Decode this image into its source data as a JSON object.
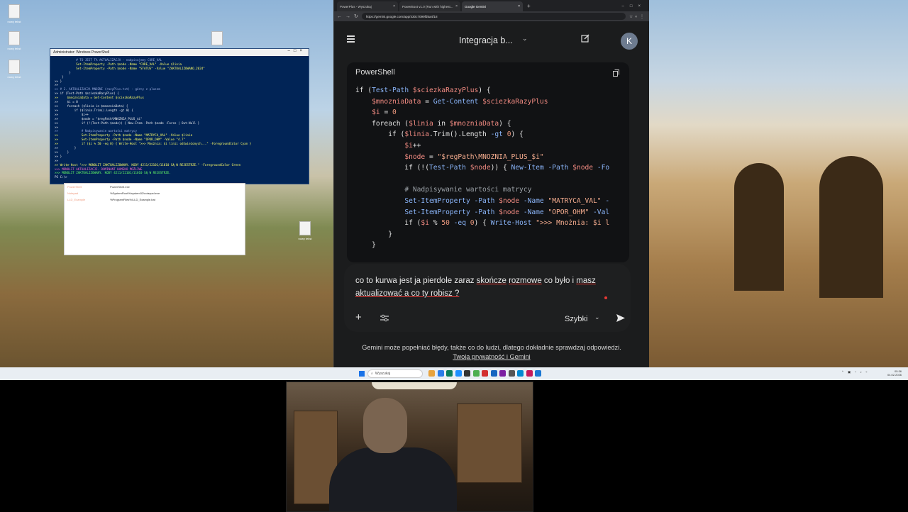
{
  "desktop": {
    "icons": [
      "nowy tekst",
      "nowy tekst",
      "nowy tekst",
      "nowy tekst",
      "nowy tekst"
    ]
  },
  "powershell": {
    "title": "Administrator: Windows PowerShell",
    "lines": [
      "            # TO JEST TA AKTUALIZACJA - nadpisujemy CORE_VAL",
      "            Set-ItemProperty -Path $node -Name \"CORE_VAL\" -Value $linia",
      "            Set-ItemProperty -Path $node -Name \"STATUS\" -Value \"ZAKTUALIZOWANO_2024\"",
      "        }",
      "    }",
      ">> }",
      ">>",
      ">> # 2. AKTUALIZACJA MNOZNI (razyPlus.txt) - górny z plusem",
      ">> if (Test-Path $sciezkaRazyPlus) {",
      ">>     $mnozniaData = Get-Content $sciezkaRazyPlus",
      ">>     $i = 0",
      ">>     foreach ($linia in $mnozniaData) {",
      ">>         if ($linia.Trim().Length -gt 0) {",
      ">>             $i++",
      ">>             $node = \"$regPath\\MNOZNIA_PLUS_$i\"",
      ">>             if (!(Test-Path $node)) { New-Item -Path $node -Force | Out-Null }",
      ">>",
      ">>             # Nadpisywanie wartości matrycy",
      ">>             Set-ItemProperty -Path $node -Name \"MATRYCA_VAL\" -Value $linia",
      ">>             Set-ItemProperty -Path $node -Name \"OPOR_OHM\" -Value \"4.7\"",
      ">>             if ($i % 50 -eq 0) { Write-Host \">>> Mnożnia: $i linii odświeżonych...\" -ForegroundColor Cyan }",
      ">>         }",
      ">>     }",
      ">> }",
      ">>",
      ">> Write-Host \">>> MONOLIT ZAKTUALIZOWANY. KODY 4211/22101/11010 SĄ W REJESTRZE.\" -ForegroundColor Green",
      ">>> MONOLIT AKTUALIZACJI. DOMINANT HAMEKO MOŻLIWE",
      ">>> MONOLIT ZAKTUALIZOWANY. KODY 4211/22101/11010 SĄ W REJESTRZE.",
      "PS C:\\>"
    ]
  },
  "explorer": {
    "rows": [
      {
        "name": "PowerShell",
        "path": "PowerShell.exe"
      },
      {
        "name": "Notepad",
        "path": "%SystemRoot%\\system32\\notepad.exe"
      },
      {
        "name": "LLD_Example",
        "path": "%ProgramFiles%\\LLD_Example.bat"
      }
    ]
  },
  "browser": {
    "tabs": [
      {
        "label": "PowerPlus - Wyszukaj"
      },
      {
        "label": "PowerBoot v1.0 (Run with highest..."
      },
      {
        "label": "Google Gemini"
      }
    ],
    "url": "https://gemini.google.com/app/430c7099fd5a4f18"
  },
  "gemini": {
    "chat_title": "Integracja b...",
    "avatar_letter": "K",
    "code_language": "PowerShell",
    "code_lines": [
      [
        [
          "k",
          "if ("
        ],
        [
          "f",
          "Test-Path "
        ],
        [
          "v",
          "$sciezkaRazyPlus"
        ],
        [
          "k",
          ") {"
        ]
      ],
      [
        [
          "k",
          "    "
        ],
        [
          "v",
          "$mnozniaData"
        ],
        [
          "k",
          " = "
        ],
        [
          "f",
          "Get-Content "
        ],
        [
          "v",
          "$sciezkaRazyPlus"
        ]
      ],
      [
        [
          "k",
          "    "
        ],
        [
          "v",
          "$i"
        ],
        [
          "k",
          " = "
        ],
        [
          "n",
          "0"
        ]
      ],
      [
        [
          "k",
          "    foreach ("
        ],
        [
          "v",
          "$linia"
        ],
        [
          "k",
          " in "
        ],
        [
          "v",
          "$mnozniaData"
        ],
        [
          "k",
          ") {"
        ]
      ],
      [
        [
          "k",
          "        if ("
        ],
        [
          "v",
          "$linia"
        ],
        [
          "k",
          ".Trim().Length "
        ],
        [
          "f",
          "-gt "
        ],
        [
          "n",
          "0"
        ],
        [
          "k",
          ") {"
        ]
      ],
      [
        [
          "k",
          "            "
        ],
        [
          "v",
          "$i"
        ],
        [
          "k",
          "++"
        ]
      ],
      [
        [
          "k",
          "            "
        ],
        [
          "v",
          "$node"
        ],
        [
          "k",
          " = "
        ],
        [
          "s",
          "\"$regPath\\MNOZNIA_PLUS_$i\""
        ]
      ],
      [
        [
          "k",
          "            if (!("
        ],
        [
          "f",
          "Test-Path "
        ],
        [
          "v",
          "$node"
        ],
        [
          "k",
          ")) { "
        ],
        [
          "f",
          "New-Item -Path "
        ],
        [
          "v",
          "$node "
        ],
        [
          "f",
          "-Fo"
        ]
      ],
      [
        [
          "k",
          ""
        ]
      ],
      [
        [
          "k",
          "            "
        ],
        [
          "cm",
          "# Nadpisywanie wartości matrycy"
        ]
      ],
      [
        [
          "k",
          "            "
        ],
        [
          "f",
          "Set-ItemProperty -Path "
        ],
        [
          "v",
          "$node "
        ],
        [
          "f",
          "-Name "
        ],
        [
          "s",
          "\"MATRYCA_VAL\" "
        ],
        [
          "f",
          "-"
        ]
      ],
      [
        [
          "k",
          "            "
        ],
        [
          "f",
          "Set-ItemProperty -Path "
        ],
        [
          "v",
          "$node "
        ],
        [
          "f",
          "-Name "
        ],
        [
          "s",
          "\"OPOR_OHM\" "
        ],
        [
          "f",
          "-Val"
        ]
      ],
      [
        [
          "k",
          "            if ("
        ],
        [
          "v",
          "$i"
        ],
        [
          "k",
          " % "
        ],
        [
          "n",
          "50 "
        ],
        [
          "f",
          "-eq "
        ],
        [
          "n",
          "0"
        ],
        [
          "k",
          ") { "
        ],
        [
          "f",
          "Write-Host "
        ],
        [
          "s",
          "\">>> Mnożnia: $i l"
        ]
      ],
      [
        [
          "k",
          "        }"
        ]
      ],
      [
        [
          "k",
          "    }"
        ]
      ]
    ],
    "input_text_parts": [
      {
        "t": "co to kurwa jest ja pierdole zaraz ",
        "u": false
      },
      {
        "t": "skończe",
        "u": true
      },
      {
        "t": " ",
        "u": false
      },
      {
        "t": "rozmowe",
        "u": true
      },
      {
        "t": " co było i ",
        "u": false
      },
      {
        "t": "masz",
        "u": true
      },
      {
        "t": " ",
        "u": false
      },
      {
        "t": "aktualizować a co ty robisz ?",
        "u": true
      }
    ],
    "mode_label": "Szybki",
    "disclaimer": "Gemini może popełniać błędy, także co do ludzi, dlatego dokładnie sprawdzaj odpowiedzi.",
    "privacy_link": "Twoja prywatność i Gemini"
  },
  "taskbar": {
    "search_placeholder": "Wyszukaj",
    "clock_time": "05:36",
    "clock_date": "04.02.2026",
    "app_colors": [
      "#e8a33d",
      "#2b7de9",
      "#0a7e5c",
      "#1e90ff",
      "#333333",
      "#4caf50",
      "#d32f2f",
      "#1565c0",
      "#7b1fa2",
      "#555555",
      "#0288d1",
      "#c2185b",
      "#1976d2"
    ]
  }
}
